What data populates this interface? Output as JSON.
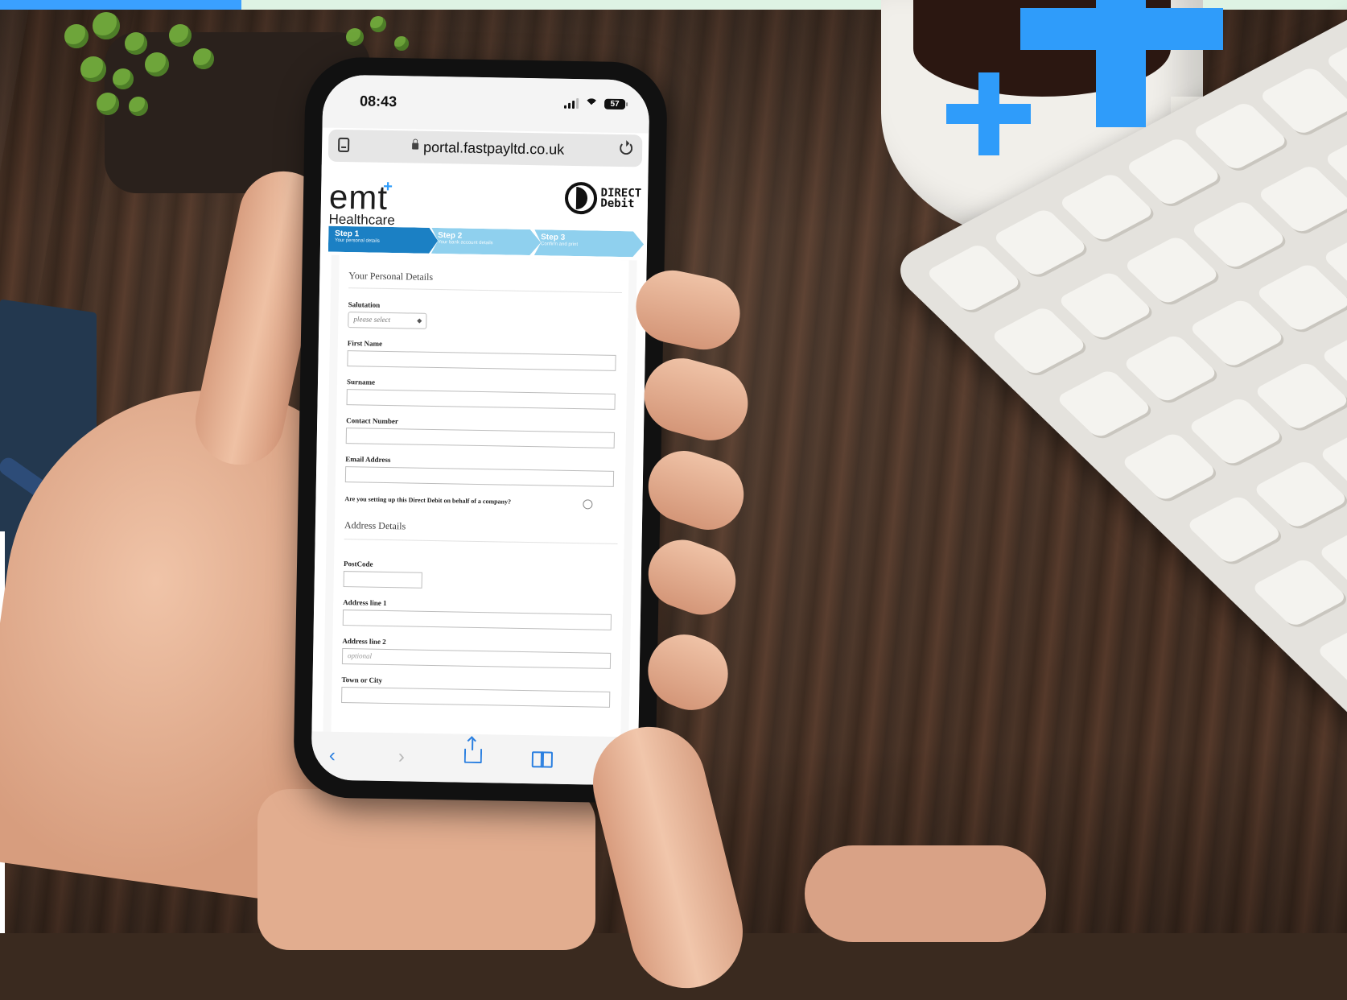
{
  "phone": {
    "time": "08:43",
    "battery": "57",
    "url": "portal.fastpayltd.co.uk"
  },
  "brand": {
    "logo": "emt",
    "logo_plus": "+",
    "name": "Healthcare",
    "dd_line1": "DIRECT",
    "dd_line2": "Debit"
  },
  "steps": [
    {
      "label": "Step 1",
      "sub": "Your personal details",
      "state": "active"
    },
    {
      "label": "Step 2",
      "sub": "Your bank account details",
      "state": "todo"
    },
    {
      "label": "Step 3",
      "sub": "Confirm and print",
      "state": "todo"
    }
  ],
  "form": {
    "personal_title": "Your Personal Details",
    "salutation_label": "Salutation",
    "salutation_value": "please select",
    "first_name_label": "First Name",
    "surname_label": "Surname",
    "contact_label": "Contact Number",
    "email_label": "Email Address",
    "company_question": "Are you setting up this Direct Debit on behalf of a company?",
    "address_title": "Address Details",
    "postcode_label": "PostCode",
    "address1_label": "Address line 1",
    "address2_label": "Address line 2",
    "address2_placeholder": "optional",
    "town_label": "Town or City"
  },
  "toolbar": {
    "back": "‹",
    "forward": "›"
  },
  "colors": {
    "accent_blue": "#2f9cfa",
    "step_active": "#1b80c4",
    "step_todo": "#8fd0ee"
  }
}
